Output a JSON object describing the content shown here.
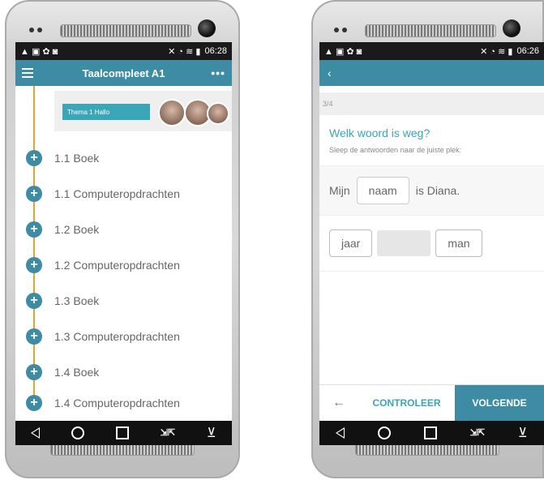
{
  "left_phone": {
    "status": {
      "left_icons": "▲ ▣ ✿ ◙",
      "right_icons": "✕ ◔ ≋ ▮",
      "time": "06:28"
    },
    "appbar": {
      "title": "Taalcompleet A1",
      "more": "•••"
    },
    "banner": {
      "tag": "Thema 1  Hallo"
    },
    "items": [
      {
        "plus": "+",
        "label": "1.1 Boek"
      },
      {
        "plus": "+",
        "label": "1.1 Computeropdrachten"
      },
      {
        "plus": "+",
        "label": "1.2 Boek"
      },
      {
        "plus": "+",
        "label": "1.2 Computeropdrachten"
      },
      {
        "plus": "+",
        "label": "1.3 Boek"
      },
      {
        "plus": "+",
        "label": "1.3 Computeropdrachten"
      },
      {
        "plus": "+",
        "label": "1.4 Boek"
      },
      {
        "plus": "+",
        "label": "1.4 Computeropdrachten"
      }
    ]
  },
  "right_phone": {
    "status": {
      "left_icons": "▲ ▣ ✿ ◙",
      "right_icons": "✕ ◔ ≋ ▮",
      "time": "06:26"
    },
    "appbar": {
      "back": "‹"
    },
    "progress": "3/4",
    "question": {
      "title": "Welk woord is weg?",
      "instruction": "Sleep de antwoorden naar de juiste plek:",
      "sentence_before": "Mijn",
      "filled_word": "naam",
      "sentence_after": "is Diana."
    },
    "answers": [
      "jaar",
      "man"
    ],
    "footer": {
      "back": "←",
      "check": "CONTROLEER",
      "next": "VOLGENDE"
    }
  },
  "nav": {
    "collapse_icon": "⇲⇱",
    "down": "⊻"
  }
}
